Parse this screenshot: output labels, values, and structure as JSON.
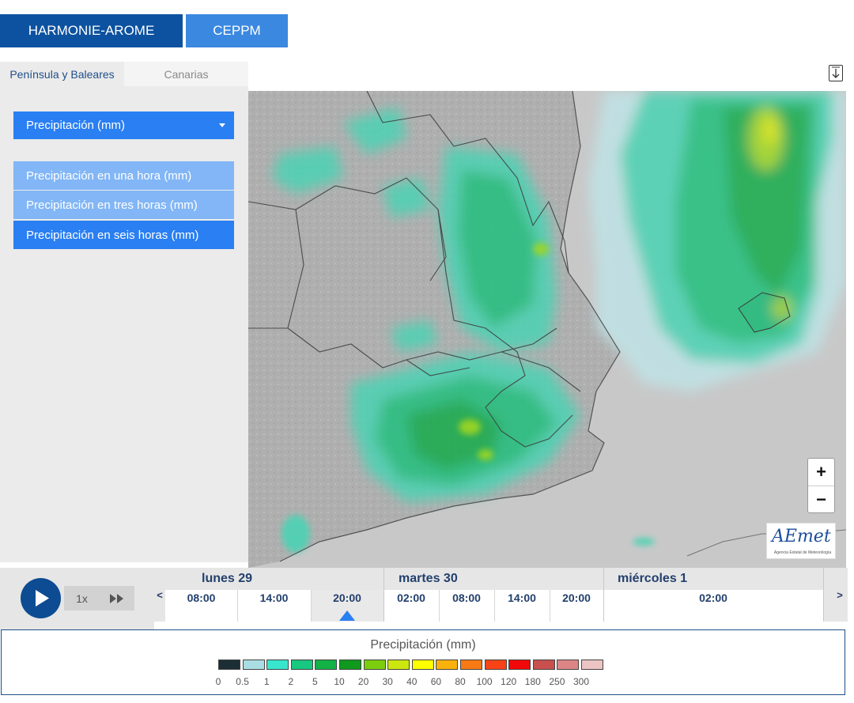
{
  "models": [
    {
      "label": "HARMONIE-AROME",
      "active": true
    },
    {
      "label": "CEPPM",
      "active": false
    }
  ],
  "region_tabs": [
    {
      "label": "Península y Baleares",
      "active": true
    },
    {
      "label": "Canarias",
      "active": false
    }
  ],
  "variable_select": {
    "value": "Precipitación (mm)"
  },
  "variable_options": [
    {
      "label": "Precipitación en una hora (mm)",
      "selected": false
    },
    {
      "label": "Precipitación en tres horas (mm)",
      "selected": false
    },
    {
      "label": "Precipitación en seis horas (mm)",
      "selected": true
    }
  ],
  "map": {
    "zoom_in": "+",
    "zoom_out": "−",
    "logo_text": "AEmet",
    "logo_subtext": "Agencia Estatal de Meteorología"
  },
  "player": {
    "speed": "1x",
    "play_icon": "play-icon",
    "fast_forward_icon": "fast-forward-icon"
  },
  "timeline": {
    "prev": "<",
    "next": ">",
    "days": [
      "lunes 29",
      "martes 30",
      "miércoles 1"
    ],
    "hours": [
      "08:00",
      "14:00",
      "20:00",
      "02:00",
      "08:00",
      "14:00",
      "20:00",
      "02:00"
    ],
    "selected_hour": "20:00"
  },
  "legend": {
    "title": "Precipitación (mm)",
    "colors": [
      "#1c2e35",
      "#a9dde3",
      "#38e6cc",
      "#18c780",
      "#12b246",
      "#0f9a1e",
      "#7ccd0e",
      "#cbe70f",
      "#ffff00",
      "#f9b10b",
      "#f87a15",
      "#f74316",
      "#f2080a",
      "#c9504f",
      "#db8585",
      "#ecc4c4"
    ],
    "labels": [
      "0",
      "0.5",
      "1",
      "2",
      "5",
      "10",
      "20",
      "30",
      "40",
      "60",
      "80",
      "100",
      "120",
      "180",
      "250",
      "300"
    ]
  }
}
